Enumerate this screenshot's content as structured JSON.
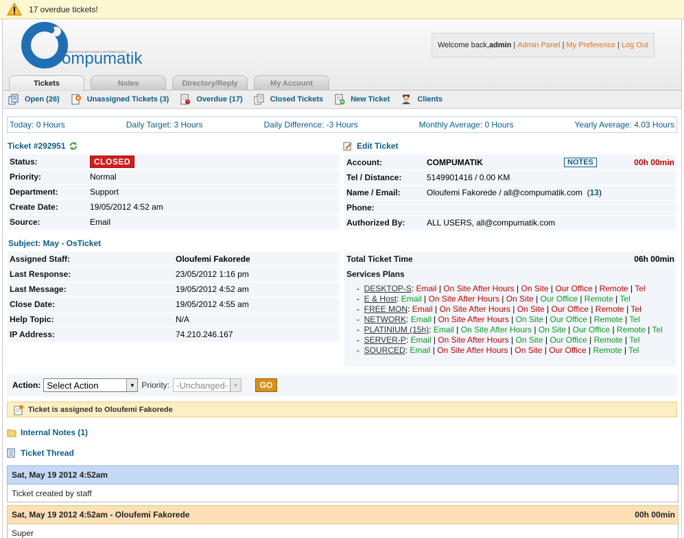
{
  "alert": {
    "text": "17 overdue tickets!"
  },
  "logo": {
    "text": "ompumatik",
    "tagline": "TECHNOLOGY ● SOLUTIONS ● INFORMATIQUES"
  },
  "user": {
    "welcome": "Welcome back, ",
    "name": "admin",
    "admin_panel": "Admin Panel",
    "preferences": "My Preference",
    "logout": "Log Out"
  },
  "tabs": [
    {
      "label": "Tickets"
    },
    {
      "label": "Notes"
    },
    {
      "label": "Directory/Reply"
    },
    {
      "label": "My Account"
    }
  ],
  "subnav": [
    {
      "label": "Open (26)",
      "icon": "tickets-icon"
    },
    {
      "label": "Unassigned Tickets (3)",
      "icon": "unassigned-icon"
    },
    {
      "label": "Overdue (17)",
      "icon": "overdue-icon"
    },
    {
      "label": "Closed Tickets",
      "icon": "closed-tickets-icon"
    },
    {
      "label": "New Ticket",
      "icon": "new-ticket-icon"
    },
    {
      "label": "Clients",
      "icon": "clients-icon"
    }
  ],
  "stats": {
    "today": "Today: 0 Hours",
    "daily_target": "Daily Target: 3 Hours",
    "daily_diff": "Daily Difference: -3 Hours",
    "monthly": "Monthly Average: 0 Hours",
    "yearly": "Yearly Average: 4.03 Hours"
  },
  "ticket": {
    "number": "Ticket #292951",
    "status_label": "Status:",
    "status": "CLOSED",
    "priority_label": "Priority:",
    "priority": "Normal",
    "department_label": "Department:",
    "department": "Support",
    "create_label": "Create Date:",
    "create_date": "19/05/2012 4:52 am",
    "source_label": "Source:",
    "source": "Email"
  },
  "account": {
    "edit_label": "Edit Ticket",
    "account_label": "Account:",
    "account": "COMPUMATIK",
    "notes_button": "NOTES",
    "time": "00h 00min",
    "tel_label": "Tel / Distance:",
    "tel": "5149901416 / 0.00 KM",
    "name_label": "Name / Email:",
    "name": "Oloufemi Fakorede / all@compumatik.com",
    "name_count": "13",
    "phone_label": "Phone:",
    "phone": "",
    "auth_label": "Authorized By:",
    "auth": "ALL USERS, all@compumatik.com"
  },
  "subject": {
    "text": "Subject: May - OsTicket"
  },
  "details": {
    "staff_label": "Assigned Staff:",
    "staff": "Oloufemi Fakorede",
    "last_resp_label": "Last Response:",
    "last_resp": "23/05/2012 1:16 pm",
    "last_msg_label": "Last Message:",
    "last_msg": "19/05/2012 4:52 am",
    "close_label": "Close Date:",
    "close": "19/05/2012 4:55 am",
    "help_label": "Help Topic:",
    "help": "N/A",
    "ip_label": "IP Address:",
    "ip": "74.210.246.167"
  },
  "time_total": {
    "label": "Total Ticket Time",
    "value": "06h 00min",
    "services_label": "Services Plans"
  },
  "plans": [
    {
      "name": "DESKTOP-S",
      "opts": [
        {
          "t": "Email",
          "c": "red"
        },
        {
          "t": "On Site After Hours",
          "c": "red"
        },
        {
          "t": "On Site",
          "c": "red"
        },
        {
          "t": "Our Office",
          "c": "red"
        },
        {
          "t": "Remote",
          "c": "red"
        },
        {
          "t": "Tel",
          "c": "red"
        }
      ]
    },
    {
      "name": "E & Host",
      "opts": [
        {
          "t": "Email",
          "c": "green"
        },
        {
          "t": "On Site After Hours",
          "c": "red"
        },
        {
          "t": "On Site",
          "c": "red"
        },
        {
          "t": "Our Office",
          "c": "green"
        },
        {
          "t": "Remote",
          "c": "green"
        },
        {
          "t": "Tel",
          "c": "green"
        }
      ]
    },
    {
      "name": "FREE MON",
      "opts": [
        {
          "t": "Email",
          "c": "red"
        },
        {
          "t": "On Site After Hours",
          "c": "red"
        },
        {
          "t": "On Site",
          "c": "red"
        },
        {
          "t": "Our Office",
          "c": "red"
        },
        {
          "t": "Remote",
          "c": "red"
        },
        {
          "t": "Tel",
          "c": "red"
        }
      ]
    },
    {
      "name": "NETWORK",
      "opts": [
        {
          "t": "Email",
          "c": "green"
        },
        {
          "t": "On Site After Hours",
          "c": "red"
        },
        {
          "t": "On Site",
          "c": "green"
        },
        {
          "t": "Our Office",
          "c": "green"
        },
        {
          "t": "Remote",
          "c": "green"
        },
        {
          "t": "Tel",
          "c": "green"
        }
      ]
    },
    {
      "name": "PLATINIUM (15h)",
      "opts": [
        {
          "t": "Email",
          "c": "green"
        },
        {
          "t": "On Site After Hours",
          "c": "green"
        },
        {
          "t": "On Site",
          "c": "green"
        },
        {
          "t": "Our Office",
          "c": "green"
        },
        {
          "t": "Remote",
          "c": "green"
        },
        {
          "t": "Tel",
          "c": "green"
        }
      ]
    },
    {
      "name": "SERVER-P",
      "opts": [
        {
          "t": "Email",
          "c": "green"
        },
        {
          "t": "On Site After Hours",
          "c": "red"
        },
        {
          "t": "On Site",
          "c": "green"
        },
        {
          "t": "Our Office",
          "c": "green"
        },
        {
          "t": "Remote",
          "c": "green"
        },
        {
          "t": "Tel",
          "c": "green"
        }
      ]
    },
    {
      "name": "SOURCED",
      "opts": [
        {
          "t": "Email",
          "c": "green"
        },
        {
          "t": "On Site After Hours",
          "c": "red"
        },
        {
          "t": "On Site",
          "c": "red"
        },
        {
          "t": "Our Office",
          "c": "red"
        },
        {
          "t": "Remote",
          "c": "green"
        },
        {
          "t": "Tel",
          "c": "green"
        }
      ]
    }
  ],
  "action": {
    "label": "Action:",
    "select": "Select Action",
    "priority_label": "Priority:",
    "priority_select": "-Unchanged-",
    "go": "GO"
  },
  "assigned": {
    "text": "Ticket is assigned to Oloufemi Fakorede"
  },
  "internal_notes": {
    "text": "Internal Notes (1)"
  },
  "thread": {
    "title": "Ticket Thread"
  },
  "entries": [
    {
      "header": "Sat, May 19 2012 4:52am",
      "time": "",
      "body": "Ticket created by staff"
    },
    {
      "header": "Sat, May 19 2012 4:52am - Oloufemi Fakorede",
      "time": "00h 00min",
      "body": "Super"
    }
  ],
  "colors": {
    "link": "#0a5c8a",
    "accent_orange": "#e0781b",
    "closed_red": "#d21e1e",
    "ok_green": "#0a9a22"
  }
}
